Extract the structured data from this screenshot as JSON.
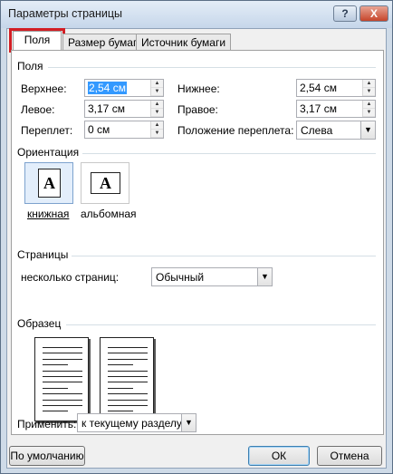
{
  "window": {
    "title": "Параметры страницы",
    "help_label": "?",
    "close_label": "X"
  },
  "tabs": [
    "Поля",
    "Размер бумаги",
    "Источник бумаги"
  ],
  "margins": {
    "section_title": "Поля",
    "top_label": "Верхнее:",
    "top_value": "2,54 см",
    "bottom_label": "Нижнее:",
    "bottom_value": "2,54 см",
    "left_label": "Левое:",
    "left_value": "3,17 см",
    "right_label": "Правое:",
    "right_value": "3,17 см",
    "gutter_label": "Переплет:",
    "gutter_value": "0 см",
    "gutter_pos_label": "Положение переплета:",
    "gutter_pos_value": "Слева"
  },
  "orientation": {
    "section_title": "Ориентация",
    "portrait_label": "книжная",
    "landscape_label": "альбомная",
    "icon_letter": "A",
    "selected": "portrait"
  },
  "pages": {
    "section_title": "Страницы",
    "multiple_label": "несколько страниц:",
    "multiple_value": "Обычный"
  },
  "preview": {
    "section_title": "Образец"
  },
  "apply": {
    "label": "Применить:",
    "value": "к текущему разделу"
  },
  "buttons": {
    "default_label": "По умолчанию",
    "ok_label": "ОК",
    "cancel_label": "Отмена"
  }
}
